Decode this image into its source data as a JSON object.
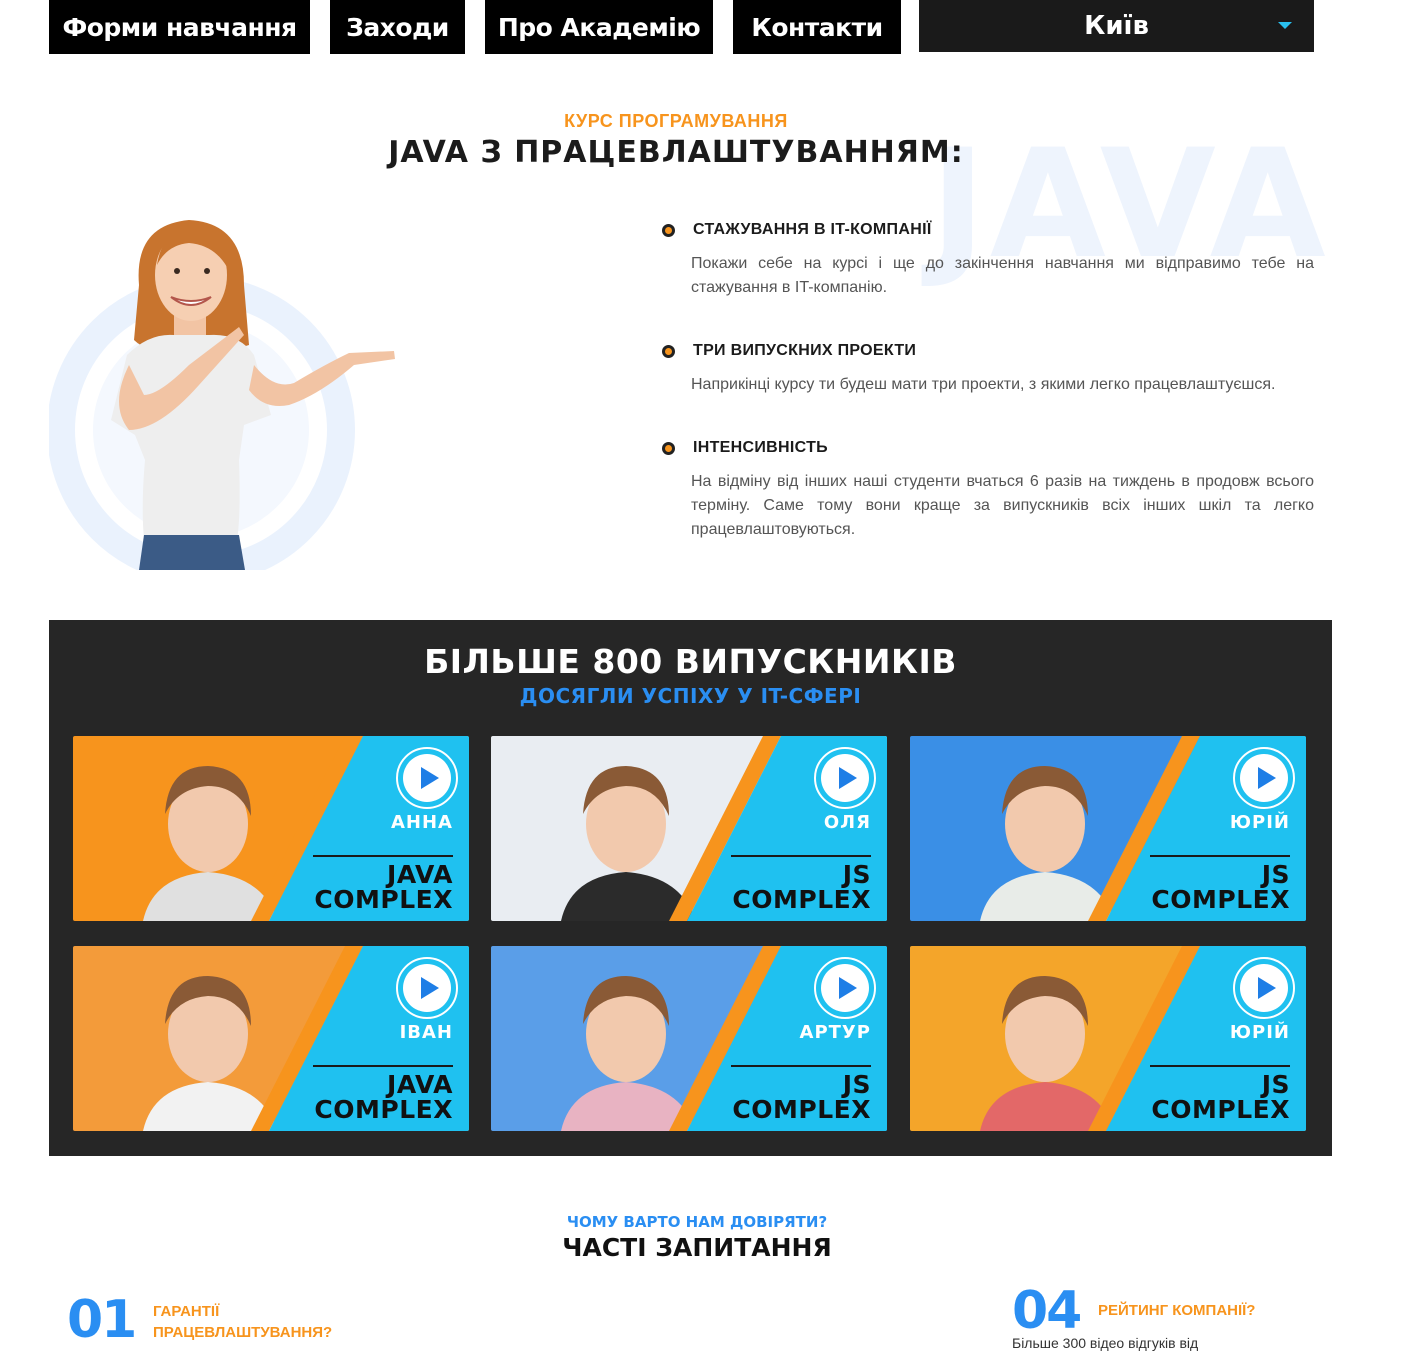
{
  "nav": {
    "items": [
      "Форми навчання",
      "Заходи",
      "Про Академію",
      "Контакти"
    ],
    "city": "Київ"
  },
  "course": {
    "kicker": "КУРС ПРОГРАМУВАННЯ",
    "title": "JAVA З ПРАЦЕВЛАШТУВАННЯМ:",
    "watermark": "JAVA"
  },
  "features": [
    {
      "title": "СТАЖУВАННЯ В IT-КОМПАНІЇ",
      "text": "Покажи себе на курсі і ще до закінчення навчання ми відправимо тебе на стажування в IT-компанію."
    },
    {
      "title": "ТРИ ВИПУСКНИХ ПРОЕКТИ",
      "text": "Наприкінці курсу ти будеш мати три проекти, з якими легко працевлаштуєшся."
    },
    {
      "title": "ІНТЕНСИВНІСТЬ",
      "text": "На відміну від інших наші студенти вчаться 6 разів на тиждень в продовж всього терміну. Саме тому вони краще за випускників всіх інших шкіл та легко працевлаштовуються."
    }
  ],
  "graduates": {
    "title": "БІЛЬШЕ 800 ВИПУСКНИКІВ",
    "subtitle": "ДОСЯГЛИ УСПІХУ У IT-СФЕРІ",
    "cards": [
      {
        "name": "АННА",
        "course_line1": "JAVA",
        "course_line2": "COMPLEX",
        "photo_bg": "#f7941d",
        "shirt": "#e0e0e0"
      },
      {
        "name": "ОЛЯ",
        "course_line1": "JS",
        "course_line2": "COMPLEX",
        "photo_bg": "#e9edf2",
        "shirt": "#2b2b2b"
      },
      {
        "name": "ЮРІЙ",
        "course_line1": "JS",
        "course_line2": "COMPLEX",
        "photo_bg": "#3a8fe6",
        "shirt": "#e8ece8"
      },
      {
        "name": "ІВАН",
        "course_line1": "JAVA",
        "course_line2": "COMPLEX",
        "photo_bg": "#f39b3a",
        "shirt": "#f2f2f2"
      },
      {
        "name": "АРТУР",
        "course_line1": "JS",
        "course_line2": "COMPLEX",
        "photo_bg": "#5a9ee8",
        "shirt": "#e8b3c2"
      },
      {
        "name": "ЮРІЙ",
        "course_line1": "JS",
        "course_line2": "COMPLEX",
        "photo_bg": "#f4a52a",
        "shirt": "#e36868"
      }
    ]
  },
  "faq": {
    "kicker": "ЧОМУ ВАРТО НАМ ДОВІРЯТИ?",
    "title": "ЧАСТІ ЗАПИТАННЯ",
    "items": [
      {
        "num": "01",
        "question_line1": "ГАРАНТІЇ",
        "question_line2": "ПРАЦЕВЛАШТУВАННЯ?",
        "answer": ""
      },
      {
        "num": "04",
        "question_line1": "РЕЙТИНГ КОМПАНІЇ?",
        "question_line2": "",
        "answer": "Більше 300 відео відгуків від"
      }
    ]
  },
  "colors": {
    "accent_orange": "#f7941d",
    "accent_blue": "#2a8ef2",
    "card_cyan": "#1fc1f0"
  }
}
